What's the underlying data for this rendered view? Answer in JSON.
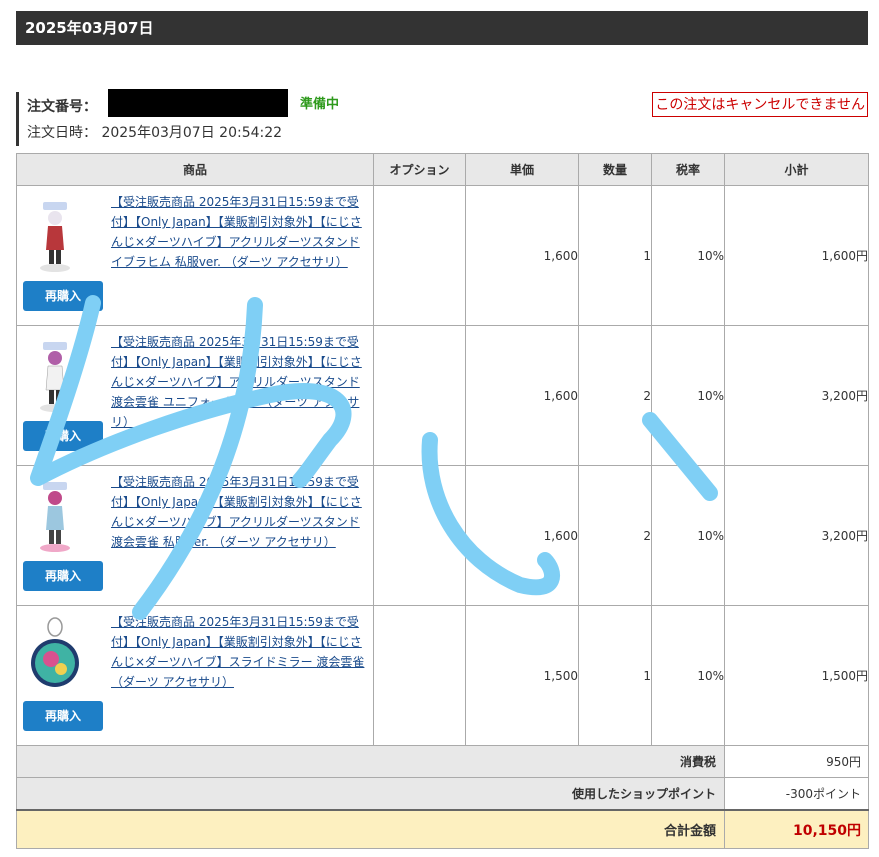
{
  "header": {
    "date": "2025年03月07日"
  },
  "order": {
    "number_label": "注文番号：",
    "status": "準備中",
    "date_label": "注文日時：",
    "date_value": "2025年03月07日 20:54:22",
    "cancel_notice": "この注文はキャンセルできません"
  },
  "table": {
    "headers": [
      "商品",
      "オプション",
      "単価",
      "数量",
      "税率",
      "小計"
    ],
    "rows": [
      {
        "name": "【受注販売商品 2025年3月31日15:59まで受付】【Only Japan】【業販割引対象外】【にじさんじ×ダーツハイブ】アクリルダーツスタンド イブラヒム 私服ver. （ダーツ アクセサリ）",
        "option": "",
        "unit_price": "1,600",
        "qty": "1",
        "tax": "10%",
        "subtotal": "1,600円",
        "rebuy": "再購入"
      },
      {
        "name": "【受注販売商品 2025年3月31日15:59まで受付】【Only Japan】【業販割引対象外】【にじさんじ×ダーツハイブ】アクリルダーツスタンド 渡会雲雀 ユニフォームver. （ダーツ アクセサリ）",
        "option": "",
        "unit_price": "1,600",
        "qty": "2",
        "tax": "10%",
        "subtotal": "3,200円",
        "rebuy": "再購入"
      },
      {
        "name": "【受注販売商品 2025年3月31日15:59まで受付】【Only Japan】【業販割引対象外】【にじさんじ×ダーツハイブ】アクリルダーツスタンド 渡会雲雀 私服ver. （ダーツ アクセサリ）",
        "option": "",
        "unit_price": "1,600",
        "qty": "2",
        "tax": "10%",
        "subtotal": "3,200円",
        "rebuy": "再購入"
      },
      {
        "name": "【受注販売商品 2025年3月31日15:59まで受付】【Only Japan】【業販割引対象外】【にじさんじ×ダーツハイブ】スライドミラー 渡会雲雀 （ダーツ アクセサリ）",
        "option": "",
        "unit_price": "1,500",
        "qty": "1",
        "tax": "10%",
        "subtotal": "1,500円",
        "rebuy": "再購入"
      }
    ],
    "tax_label": "消費税",
    "tax_value": "950円",
    "points_label": "使用したショップポイント",
    "points_value": "-300ポイント",
    "total_label": "合計金額",
    "total_value": "10,150円"
  },
  "colors": {
    "header_bg": "#333333",
    "status": "#2e9a1c",
    "cancel": "#cc0000",
    "rebuy_button": "#1e7fc7",
    "total_bg": "#fdf0c0",
    "total_text": "#c00000",
    "scribble": "#7fcff5"
  },
  "icons": [
    "product-thumbnail-acrylic-stand",
    "product-thumbnail-mirror"
  ]
}
